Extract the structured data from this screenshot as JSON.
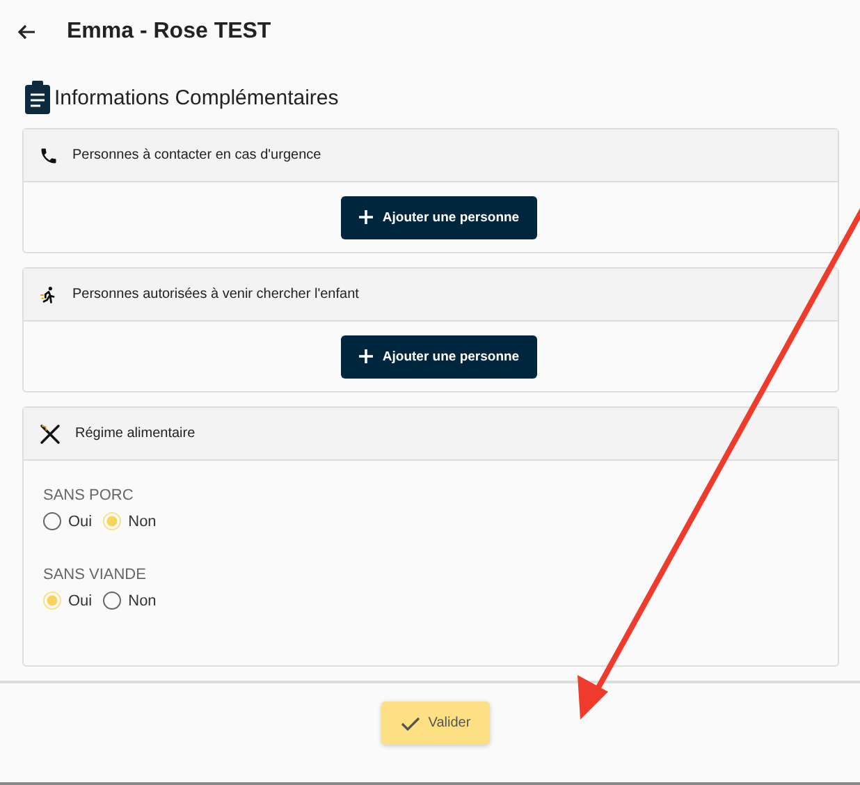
{
  "header": {
    "title": "Emma - Rose TEST"
  },
  "section_title": "Informations Complémentaires",
  "panels": [
    {
      "kind": "people",
      "title": "Personnes à contacter en cas d'urgence",
      "button": "Ajouter une personne"
    },
    {
      "kind": "people",
      "title": "Personnes autorisées à venir chercher l'enfant",
      "button": "Ajouter une personne"
    },
    {
      "kind": "diet",
      "title": "Régime alimentaire",
      "questions": [
        {
          "label": "SANS PORC",
          "options": [
            {
              "label": "Oui",
              "selected": false
            },
            {
              "label": "Non",
              "selected": true
            }
          ]
        },
        {
          "label": "SANS VIANDE",
          "options": [
            {
              "label": "Oui",
              "selected": true
            },
            {
              "label": "Non",
              "selected": false
            }
          ]
        }
      ]
    }
  ],
  "submit": "Valider"
}
